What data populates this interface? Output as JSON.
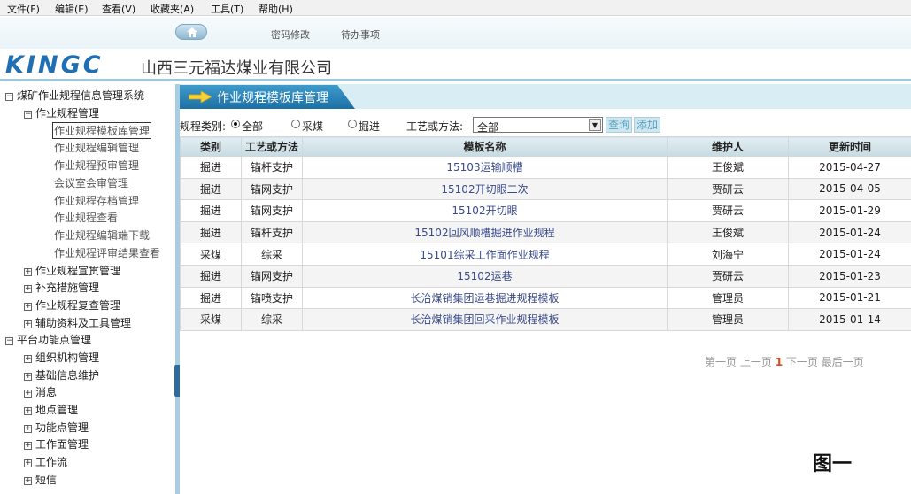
{
  "menu": [
    "文件(F)",
    "编辑(E)",
    "查看(V)",
    "收藏夹(A)",
    "工具(T)",
    "帮助(H)"
  ],
  "topnav": {
    "links": [
      "密码修改",
      "待办事项"
    ]
  },
  "brand": {
    "logo": "KINGC",
    "company": "山西三元福达煤业有限公司"
  },
  "sidebar": {
    "root": "煤矿作业规程信息管理系统",
    "group1": "作业规程管理",
    "leaves": [
      "作业规程模板库管理",
      "作业规程编辑管理",
      "作业规程预审管理",
      "会议室会审管理",
      "作业规程存档管理",
      "作业规程查看",
      "作业规程编辑端下载",
      "作业规程评审结果查看"
    ],
    "groups": [
      "作业规程宣贯管理",
      "补充措施管理",
      "作业规程复查管理",
      "辅助资料及工具管理"
    ],
    "root2": "平台功能点管理",
    "groups2": [
      "组织机构管理",
      "基础信息维护",
      "消息",
      "地点管理",
      "功能点管理",
      "工作面管理",
      "工作流",
      "短信"
    ]
  },
  "main": {
    "title": "作业规程模板库管理",
    "filter": {
      "type_label": "规程类别:",
      "options": [
        "全部",
        "采煤",
        "掘进"
      ],
      "selected_option": "全部",
      "method_label": "工艺或方法:",
      "method_value": "全部",
      "query_button": "查询",
      "add_button": "添加"
    },
    "table": {
      "headers": [
        "类别",
        "工艺或方法",
        "模板名称",
        "维护人",
        "更新时间"
      ],
      "rows": [
        [
          "掘进",
          "锚杆支护",
          "15103运输顺槽",
          "王俊斌",
          "2015-04-27"
        ],
        [
          "掘进",
          "锚网支护",
          "15102开切眼二次",
          "贾研云",
          "2015-04-05"
        ],
        [
          "掘进",
          "锚网支护",
          "15102开切眼",
          "贾研云",
          "2015-01-29"
        ],
        [
          "掘进",
          "锚杆支护",
          "15102回风顺槽掘进作业规程",
          "王俊斌",
          "2015-01-24"
        ],
        [
          "采煤",
          "综采",
          "15101综采工作面作业规程",
          "刘海宁",
          "2015-01-24"
        ],
        [
          "掘进",
          "锚网支护",
          "15102运巷",
          "贾研云",
          "2015-01-23"
        ],
        [
          "掘进",
          "锚喷支护",
          "长治煤销集团运巷掘进规程模板",
          "管理员",
          "2015-01-21"
        ],
        [
          "采煤",
          "综采",
          "长治煤销集团回采作业规程模板",
          "管理员",
          "2015-01-14"
        ]
      ]
    },
    "pager": {
      "first": "第一页",
      "prev": "上一页",
      "current": "1",
      "next": "下一页",
      "last": "最后一页"
    }
  },
  "caption": "图一"
}
